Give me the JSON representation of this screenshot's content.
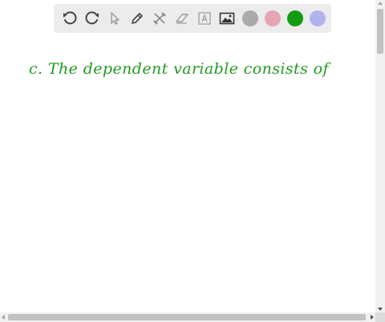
{
  "toolbar": {
    "tools": [
      {
        "id": "undo",
        "icon": "undo-icon"
      },
      {
        "id": "redo",
        "icon": "redo-icon"
      },
      {
        "id": "select",
        "icon": "pointer-icon"
      },
      {
        "id": "pen",
        "icon": "pen-icon"
      },
      {
        "id": "tools",
        "icon": "tools-icon"
      },
      {
        "id": "eraser",
        "icon": "eraser-icon"
      },
      {
        "id": "text",
        "icon": "text-icon"
      },
      {
        "id": "image",
        "icon": "image-icon"
      }
    ],
    "colors": [
      {
        "name": "gray",
        "hex": "#aaaaaa",
        "selected": false
      },
      {
        "name": "pink",
        "hex": "#e6a6b3",
        "selected": false
      },
      {
        "name": "green",
        "hex": "#119c11",
        "selected": true
      },
      {
        "name": "lavender",
        "hex": "#b2b3ec",
        "selected": false
      }
    ]
  },
  "canvas": {
    "handwritten_text": "c. The dependent variable consists of",
    "ink_color": "#1f9a1f"
  }
}
